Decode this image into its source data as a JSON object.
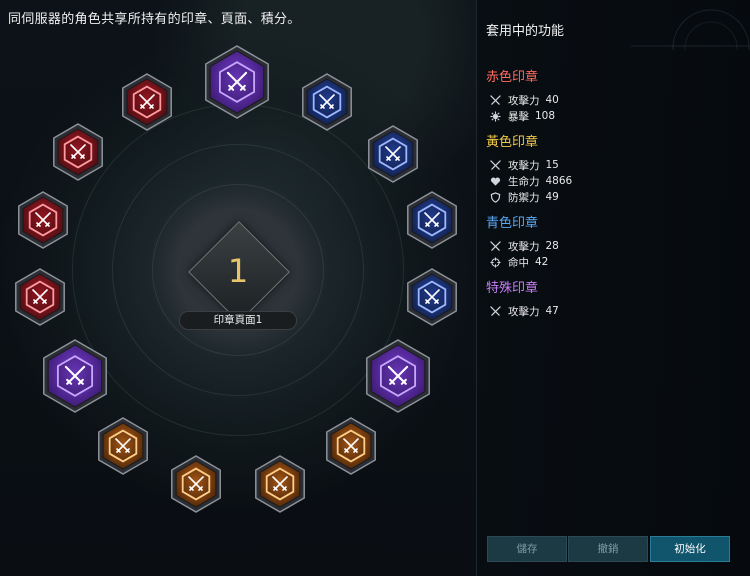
{
  "description": "同伺服器的角色共享所持有的印章、頁面、積分。",
  "page": {
    "number": "1",
    "label": "印章頁面1"
  },
  "slot_colors": {
    "purple": [
      "#3a1a6e",
      "#7a3fd8",
      "#c8a6ff"
    ],
    "blue": [
      "#10204a",
      "#2846a8",
      "#9db7ff"
    ],
    "red": [
      "#4a0d12",
      "#b01a26",
      "#ff9aa0"
    ],
    "orange": [
      "#4a2408",
      "#c0661a",
      "#ffcf8a"
    ]
  },
  "slots": [
    {
      "name": "slot-top-purple",
      "color": "purple",
      "size": "large"
    },
    {
      "name": "slot-blue-1",
      "color": "blue",
      "size": "medium"
    },
    {
      "name": "slot-blue-2",
      "color": "blue",
      "size": "medium"
    },
    {
      "name": "slot-blue-3",
      "color": "blue",
      "size": "medium"
    },
    {
      "name": "slot-blue-4",
      "color": "blue",
      "size": "medium"
    },
    {
      "name": "slot-right-purple",
      "color": "purple",
      "size": "large"
    },
    {
      "name": "slot-orange-1",
      "color": "orange",
      "size": "medium"
    },
    {
      "name": "slot-orange-2",
      "color": "orange",
      "size": "medium"
    },
    {
      "name": "slot-orange-3",
      "color": "orange",
      "size": "medium"
    },
    {
      "name": "slot-orange-4",
      "color": "orange",
      "size": "medium"
    },
    {
      "name": "slot-left-purple",
      "color": "purple",
      "size": "large"
    },
    {
      "name": "slot-red-1",
      "color": "red",
      "size": "medium"
    },
    {
      "name": "slot-red-2",
      "color": "red",
      "size": "medium"
    },
    {
      "name": "slot-red-3",
      "color": "red",
      "size": "medium"
    },
    {
      "name": "slot-red-4",
      "color": "red",
      "size": "medium"
    }
  ],
  "panel": {
    "title": "套用中的功能",
    "groups": [
      {
        "title": "赤色印章",
        "color": "#ff6a5c",
        "stats": [
          {
            "icon": "attack-icon",
            "name": "攻擊力",
            "value": "40"
          },
          {
            "icon": "crit-icon",
            "name": "暴擊",
            "value": "108"
          }
        ]
      },
      {
        "title": "黃色印章",
        "color": "#f1c84a",
        "stats": [
          {
            "icon": "attack-icon",
            "name": "攻擊力",
            "value": "15"
          },
          {
            "icon": "heart-icon",
            "name": "生命力",
            "value": "4866"
          },
          {
            "icon": "shield-icon",
            "name": "防禦力",
            "value": "49"
          }
        ]
      },
      {
        "title": "青色印章",
        "color": "#5aa8f2",
        "stats": [
          {
            "icon": "attack-icon",
            "name": "攻擊力",
            "value": "28"
          },
          {
            "icon": "target-icon",
            "name": "命中",
            "value": "42"
          }
        ]
      },
      {
        "title": "特殊印章",
        "color": "#c57ef5",
        "stats": [
          {
            "icon": "attack-icon",
            "name": "攻擊力",
            "value": "47"
          }
        ]
      }
    ]
  },
  "buttons": {
    "save": "儲存",
    "undo": "撤銷",
    "reset": "初始化"
  }
}
